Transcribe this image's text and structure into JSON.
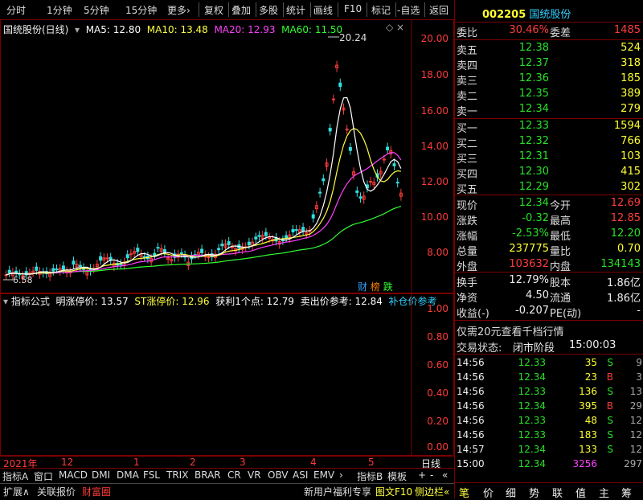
{
  "toolbar": {
    "left": [
      "分时",
      "1分钟",
      "5分钟",
      "15分钟",
      "更多›"
    ],
    "right": [
      "复权",
      "叠加",
      "多股",
      "统计",
      "画线",
      "F10",
      "标记",
      "-自选",
      "返回"
    ]
  },
  "chart": {
    "title": "国统股份(日线)",
    "ma5": "MA5: 12.80",
    "ma10": "MA10: 13.48",
    "ma20": "MA20: 12.93",
    "ma60": "MA60: 11.50",
    "max_label": "20.24",
    "min_label": "6.58",
    "yaxis": [
      "20.00",
      "18.00",
      "16.00",
      "14.00",
      "12.00",
      "10.00",
      "8.00"
    ],
    "badges": [
      "财",
      "榜",
      "跌"
    ],
    "colors": {
      "ma5": "#ffffff",
      "ma10": "#ffff40",
      "ma20": "#ff40ff",
      "ma60": "#30ff30"
    }
  },
  "indicator": {
    "label": "指标公式",
    "items": [
      {
        "text": "明涨停价: 13.57",
        "color": "#ffffff"
      },
      {
        "text": "ST涨停价: 12.96",
        "color": "#ffff40"
      },
      {
        "text": "获利1个点: 12.79",
        "color": "#ffffff"
      },
      {
        "text": "卖出价参考: 12.84",
        "color": "#ffffff"
      },
      {
        "text": "补仓价参考",
        "color": "#30d0ff"
      }
    ],
    "yaxis": [
      "1.00",
      "0.80",
      "0.60",
      "0.40",
      "0.20",
      "0.00"
    ]
  },
  "timeaxis": {
    "labels": [
      "2021年",
      "12",
      "1",
      "2",
      "3",
      "4",
      "5"
    ],
    "right": "日线"
  },
  "tabs1": [
    "指标A",
    "窗口",
    "MACD",
    "DMI",
    "DMA",
    "FSL",
    "TRIX",
    "BRAR",
    "CR",
    "VR",
    "OBV",
    "ASI",
    "EMV",
    "›",
    "指标B",
    "模板",
    "+",
    "-",
    "«"
  ],
  "tabs2": {
    "left": [
      "扩展∧",
      "关联报价",
      "财富圈"
    ],
    "right": [
      "新用户福利专享",
      "图文F10",
      "侧边栏«"
    ]
  },
  "quote": {
    "code": "002205",
    "name": "国统股份",
    "weibi_label": "委比",
    "weibi": "30.46%",
    "weicha_label": "委差",
    "weicha": "1485",
    "sells": [
      {
        "label": "卖五",
        "price": "12.38",
        "vol": "524"
      },
      {
        "label": "卖四",
        "price": "12.37",
        "vol": "318"
      },
      {
        "label": "卖三",
        "price": "12.36",
        "vol": "185"
      },
      {
        "label": "卖二",
        "price": "12.35",
        "vol": "389"
      },
      {
        "label": "卖一",
        "price": "12.34",
        "vol": "279"
      }
    ],
    "buys": [
      {
        "label": "买一",
        "price": "12.33",
        "vol": "1594"
      },
      {
        "label": "买二",
        "price": "12.32",
        "vol": "766"
      },
      {
        "label": "买三",
        "price": "12.31",
        "vol": "103"
      },
      {
        "label": "买四",
        "price": "12.30",
        "vol": "415"
      },
      {
        "label": "买五",
        "price": "12.29",
        "vol": "302"
      }
    ],
    "stats": [
      {
        "l1": "现价",
        "v1": "12.34",
        "c1": "green",
        "l2": "今开",
        "v2": "12.69",
        "c2": "red"
      },
      {
        "l1": "涨跌",
        "v1": "-0.32",
        "c1": "green",
        "l2": "最高",
        "v2": "12.85",
        "c2": "red"
      },
      {
        "l1": "涨幅",
        "v1": "-2.53%",
        "c1": "green",
        "l2": "最低",
        "v2": "12.20",
        "c2": "green"
      },
      {
        "l1": "总量",
        "v1": "237775",
        "c1": "yellow",
        "l2": "量比",
        "v2": "0.70",
        "c2": "yellow"
      },
      {
        "l1": "外盘",
        "v1": "103632",
        "c1": "red",
        "l2": "内盘",
        "v2": "134143",
        "c2": "green"
      }
    ],
    "stats2": [
      {
        "l1": "换手",
        "v1": "12.79%",
        "l2": "股本",
        "v2": "1.86亿"
      },
      {
        "l1": "净资",
        "v1": "4.50",
        "l2": "流通",
        "v2": "1.86亿"
      },
      {
        "l1": "收益(-)",
        "v1": "-0.207",
        "l2": "PE(动)",
        "v2": "-"
      }
    ],
    "promo": "仅需20元查看千档行情",
    "status_label": "交易状态:",
    "status": "闭市阶段",
    "status_time": "15:00:03",
    "ticks": [
      {
        "t": "14:56",
        "p": "12.33",
        "v": "35",
        "bs": "S",
        "n": "9"
      },
      {
        "t": "14:56",
        "p": "12.34",
        "v": "23",
        "bs": "B",
        "n": "3"
      },
      {
        "t": "14:56",
        "p": "12.33",
        "v": "136",
        "bs": "S",
        "n": "13"
      },
      {
        "t": "14:56",
        "p": "12.34",
        "v": "395",
        "bs": "B",
        "n": "29"
      },
      {
        "t": "14:56",
        "p": "12.33",
        "v": "48",
        "bs": "S",
        "n": "12"
      },
      {
        "t": "14:56",
        "p": "12.33",
        "v": "183",
        "bs": "S",
        "n": "12"
      },
      {
        "t": "14:57",
        "p": "12.34",
        "v": "133",
        "bs": "S",
        "n": "12"
      },
      {
        "t": "15:00",
        "p": "12.34",
        "v": "3256",
        "bs": "",
        "n": "297"
      }
    ],
    "bottom_tabs": [
      "笔",
      "价",
      "细",
      "势",
      "联",
      "值",
      "主",
      "筹"
    ]
  }
}
